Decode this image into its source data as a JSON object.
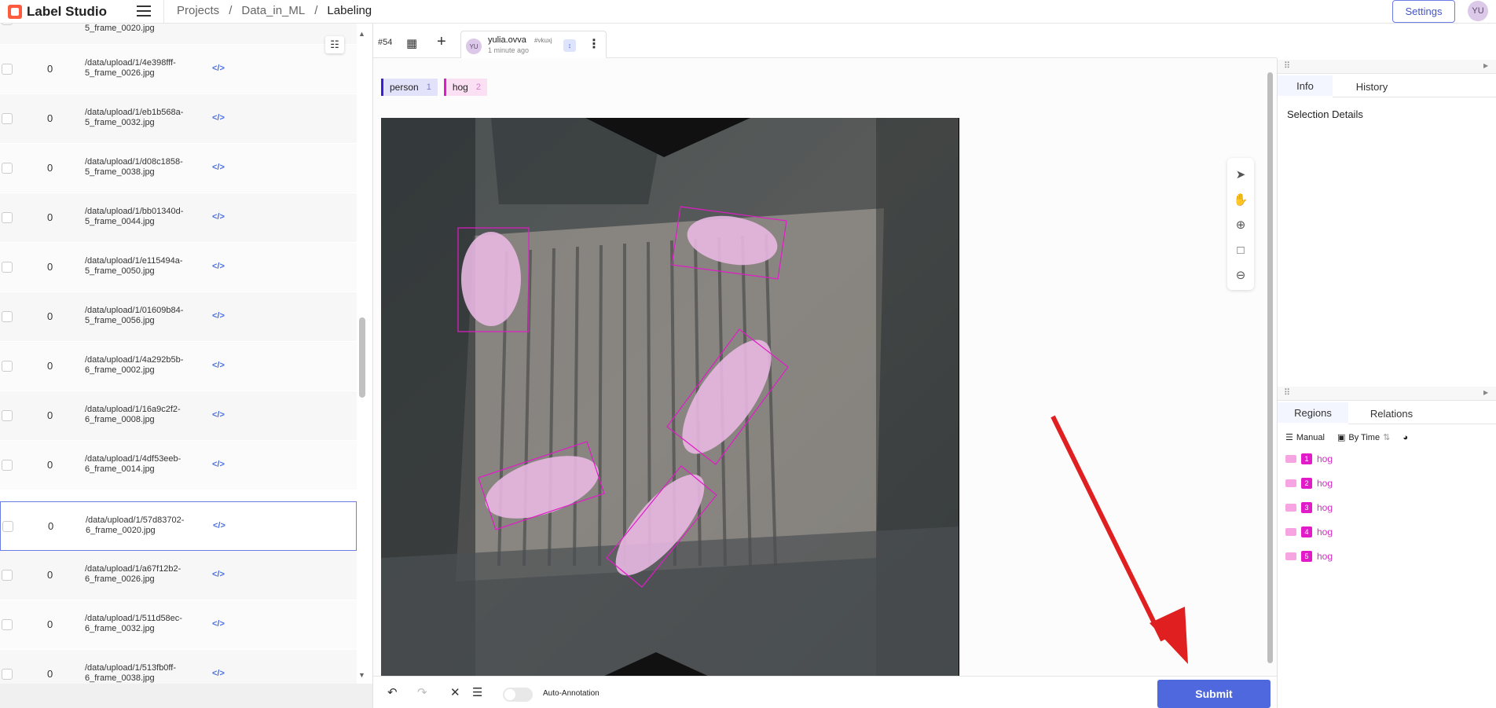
{
  "header": {
    "logo_text": "Label Studio",
    "breadcrumbs": [
      "Projects",
      "/",
      "Data_in_ML",
      "/",
      "Labeling"
    ],
    "settings_label": "Settings",
    "avatar_initials": "YU"
  },
  "task_list": {
    "rows": [
      {
        "count": "0",
        "file": "5_frame_0020.jpg"
      },
      {
        "count": "0",
        "file": "/data/upload/1/4e398fff-5_frame_0026.jpg"
      },
      {
        "count": "0",
        "file": "/data/upload/1/eb1b568a-5_frame_0032.jpg"
      },
      {
        "count": "0",
        "file": "/data/upload/1/d08c1858-5_frame_0038.jpg"
      },
      {
        "count": "0",
        "file": "/data/upload/1/bb01340d-5_frame_0044.jpg"
      },
      {
        "count": "0",
        "file": "/data/upload/1/e115494a-5_frame_0050.jpg"
      },
      {
        "count": "0",
        "file": "/data/upload/1/01609b84-5_frame_0056.jpg"
      },
      {
        "count": "0",
        "file": "/data/upload/1/4a292b5b-6_frame_0002.jpg"
      },
      {
        "count": "0",
        "file": "/data/upload/1/16a9c2f2-6_frame_0008.jpg"
      },
      {
        "count": "0",
        "file": "/data/upload/1/4df53eeb-6_frame_0014.jpg"
      },
      {
        "count": "0",
        "file": "/data/upload/1/57d83702-6_frame_0020.jpg"
      },
      {
        "count": "0",
        "file": "/data/upload/1/a67f12b2-6_frame_0026.jpg"
      },
      {
        "count": "0",
        "file": "/data/upload/1/511d58ec-6_frame_0032.jpg"
      },
      {
        "count": "0",
        "file": "/data/upload/1/513fb0ff-6_frame_0038.jpg"
      }
    ],
    "selected_index": 10
  },
  "annotation": {
    "task_id": "#54",
    "user_initials": "YU",
    "user_name": "yulia.ovva",
    "user_hash": "#vkuxj",
    "time_ago": "1 minute ago"
  },
  "labels": [
    {
      "name": "person",
      "hotkey": "1",
      "color": "#3b1fd8"
    },
    {
      "name": "hog",
      "hotkey": "2",
      "color": "#e11bc8"
    }
  ],
  "bottom": {
    "auto_annotation_label": "Auto-Annotation",
    "submit_label": "Submit"
  },
  "side": {
    "info_tabs": [
      "Info",
      "History"
    ],
    "selection_details": "Selection Details",
    "region_tabs": [
      "Regions",
      "Relations"
    ],
    "manual_label": "Manual",
    "by_time_label": "By Time",
    "regions": [
      {
        "num": "1",
        "label": "hog"
      },
      {
        "num": "2",
        "label": "hog"
      },
      {
        "num": "3",
        "label": "hog"
      },
      {
        "num": "4",
        "label": "hog"
      },
      {
        "num": "5",
        "label": "hog"
      }
    ]
  },
  "colors": {
    "accent": "#5068de",
    "hog": "#e11bc8",
    "person": "#3b1fd8",
    "annotation_arrow": "#e02020"
  }
}
